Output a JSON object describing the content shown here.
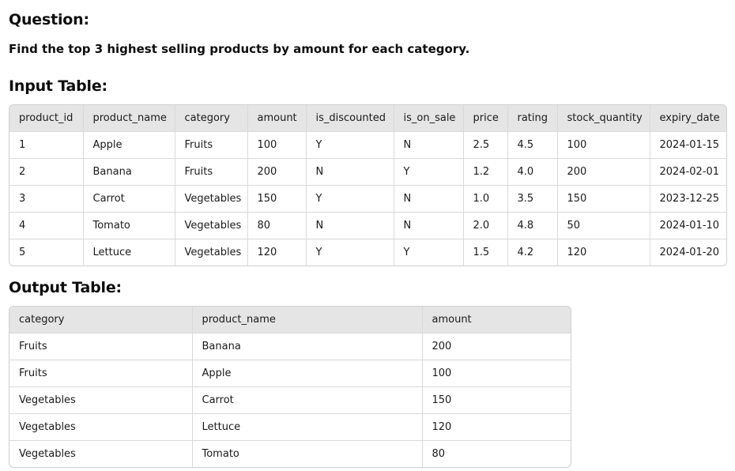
{
  "question_heading": "Question:",
  "question_text": "Find the top 3 highest selling products by amount for each category.",
  "input_heading": "Input Table:",
  "input_table": {
    "columns": [
      "product_id",
      "product_name",
      "category",
      "amount",
      "is_discounted",
      "is_on_sale",
      "price",
      "rating",
      "stock_quantity",
      "expiry_date"
    ],
    "rows": [
      [
        "1",
        "Apple",
        "Fruits",
        "100",
        "Y",
        "N",
        "2.5",
        "4.5",
        "100",
        "2024-01-15"
      ],
      [
        "2",
        "Banana",
        "Fruits",
        "200",
        "N",
        "Y",
        "1.2",
        "4.0",
        "200",
        "2024-02-01"
      ],
      [
        "3",
        "Carrot",
        "Vegetables",
        "150",
        "Y",
        "N",
        "1.0",
        "3.5",
        "150",
        "2023-12-25"
      ],
      [
        "4",
        "Tomato",
        "Vegetables",
        "80",
        "N",
        "N",
        "2.0",
        "4.8",
        "50",
        "2024-01-10"
      ],
      [
        "5",
        "Lettuce",
        "Vegetables",
        "120",
        "Y",
        "Y",
        "1.5",
        "4.2",
        "120",
        "2024-01-20"
      ]
    ]
  },
  "output_heading": "Output Table:",
  "output_table": {
    "columns": [
      "category",
      "product_name",
      "amount"
    ],
    "rows": [
      [
        "Fruits",
        "Banana",
        "200"
      ],
      [
        "Fruits",
        "Apple",
        "100"
      ],
      [
        "Vegetables",
        "Carrot",
        "150"
      ],
      [
        "Vegetables",
        "Lettuce",
        "120"
      ],
      [
        "Vegetables",
        "Tomato",
        "80"
      ]
    ]
  }
}
